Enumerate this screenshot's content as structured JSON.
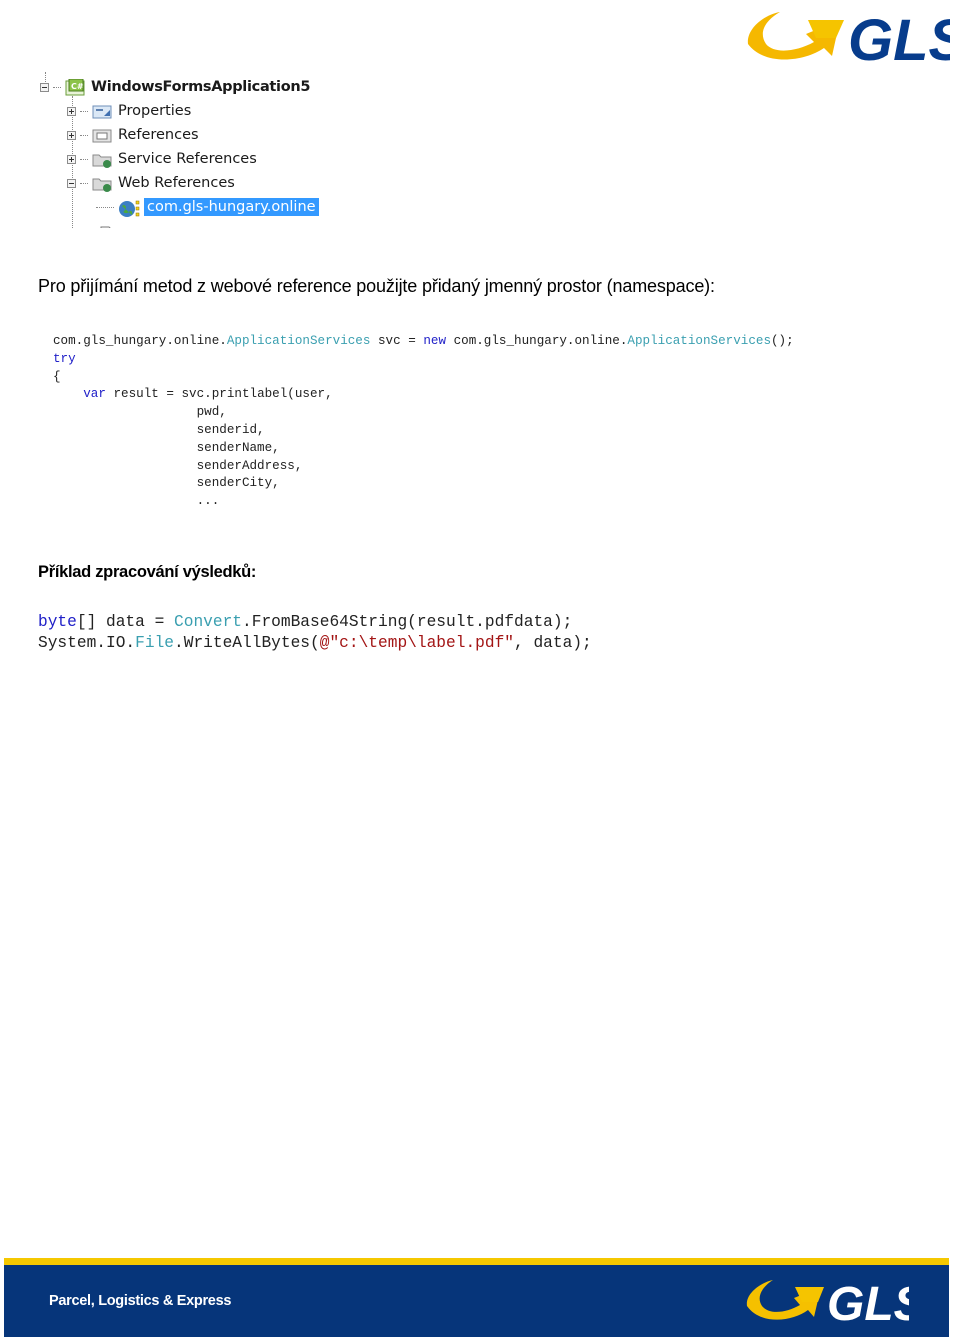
{
  "header": {
    "logo_text": "GLS",
    "logo_icon": "gls-arrow-logo",
    "brand_colors": {
      "yellow": "#f5c000",
      "blue": "#06357a"
    }
  },
  "solution_explorer": {
    "root": {
      "label": "WindowsFormsApplication5",
      "icon": "csharp-project-icon",
      "expanded": true
    },
    "items": [
      {
        "label": "Properties",
        "icon": "properties-folder-icon",
        "expander": "plus"
      },
      {
        "label": "References",
        "icon": "references-folder-icon",
        "expander": "plus"
      },
      {
        "label": "Service References",
        "icon": "service-references-folder-icon",
        "expander": "plus"
      },
      {
        "label": "Web References",
        "icon": "web-references-folder-icon",
        "expander": "minus"
      }
    ],
    "child": {
      "label": "com.gls-hungary.online",
      "icon": "web-reference-globe-icon",
      "selected": true
    }
  },
  "intro_text": "Pro přijímání metod z webové reference použijte přidaný jmenný prostor (namespace):",
  "code_block_1": {
    "line1": {
      "ns1": "com.gls_hungary.online.",
      "type1": "ApplicationServices",
      "mid": " svc = ",
      "kw_new": "new",
      "ns2": " com.gls_hungary.online.",
      "type2": "ApplicationServices",
      "end": "();"
    },
    "line2_kw": "try",
    "line3": "{",
    "line4": {
      "indent": "    ",
      "kw_var": "var",
      "rest": " result = svc.printlabel(user,"
    },
    "args": [
      "pwd,",
      "senderid,",
      "senderName,",
      "senderAddress,",
      "senderCity,",
      "..."
    ]
  },
  "results_heading": "Příklad zpracování výsledků:",
  "code_block_2": {
    "line1": {
      "kw_byte": "byte",
      "a": "[] data = ",
      "type_convert": "Convert",
      "b": ".FromBase64String(result.pdfdata);"
    },
    "line2": {
      "a": "System.IO.",
      "type_file": "File",
      "b": ".WriteAllBytes(",
      "str": "@\"c:\\temp\\label.pdf\"",
      "c": ", data);"
    }
  },
  "footer": {
    "tagline": "Parcel, Logistics & Express",
    "logo_text": "GLS"
  }
}
